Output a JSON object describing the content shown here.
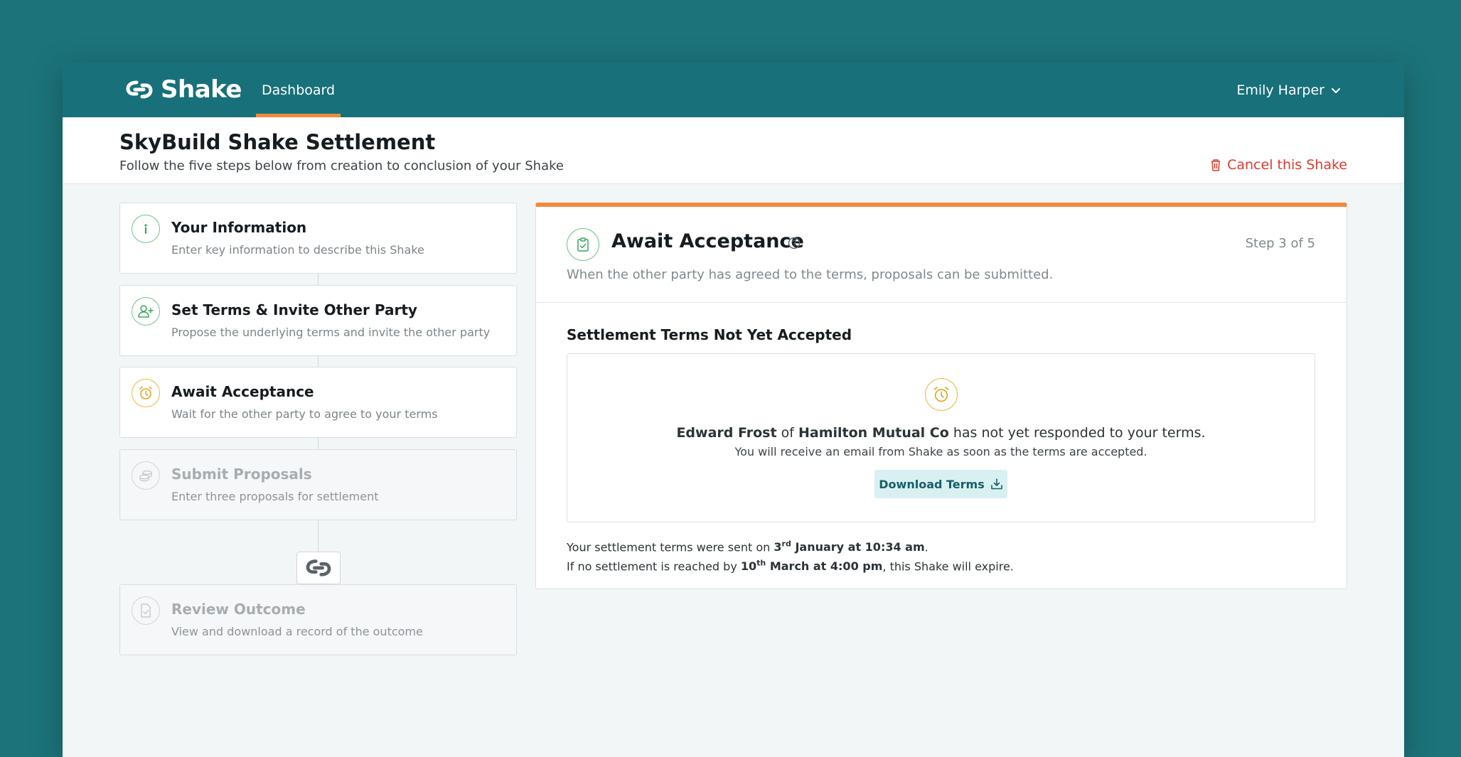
{
  "app": {
    "name": "Shake",
    "nav": {
      "dashboard": "Dashboard"
    },
    "user": {
      "name": "Emily Harper"
    }
  },
  "header": {
    "title": "SkyBuild Shake Settlement",
    "subtitle": "Follow the five steps below from creation to conclusion of your Shake",
    "cancel_label": "Cancel this Shake"
  },
  "steps": [
    {
      "title": "Your Information",
      "desc": "Enter key information to describe this Shake",
      "icon": "info-icon",
      "state": "complete"
    },
    {
      "title": "Set Terms & Invite Other Party",
      "desc": "Propose the underlying terms and invite the other party",
      "icon": "user-plus-icon",
      "state": "complete"
    },
    {
      "title": "Await Acceptance",
      "desc": "Wait for the other party to agree to your terms",
      "icon": "alarm-clock-icon",
      "state": "current"
    },
    {
      "title": "Submit Proposals",
      "desc": "Enter three proposals for settlement",
      "icon": "coins-icon",
      "state": "pending"
    },
    {
      "title": "Review Outcome",
      "desc": "View and download a record of the outcome",
      "icon": "document-check-icon",
      "state": "pending"
    }
  ],
  "panel": {
    "title": "Await Acceptance",
    "step_label": "Step 3 of 5",
    "desc": "When the other party has agreed to the terms, proposals can be submitted.",
    "section_title": "Settlement Terms Not Yet Accepted",
    "status": {
      "person": "Edward Frost",
      "of": "of",
      "company": "Hamilton Mutual Co",
      "message": "has not yet responded to your terms.",
      "note": "You will receive an email from Shake as soon as the terms are accepted.",
      "download_label": "Download Terms"
    },
    "sent": {
      "prefix": "Your settlement terms were sent on",
      "day": "3",
      "day_suffix": "rd",
      "date_rest": "January at 10:34 am",
      "suffix": "."
    },
    "expire": {
      "prefix": "If no settlement is reached by",
      "day": "10",
      "day_suffix": "th",
      "date_rest": "March at 4:00 pm",
      "suffix": ", this Shake will expire."
    }
  },
  "colors": {
    "brand": "#17707a",
    "accent": "#f08a3c",
    "danger": "#e03a2f",
    "success": "#6fc48a",
    "pending": "#f0b93a"
  }
}
